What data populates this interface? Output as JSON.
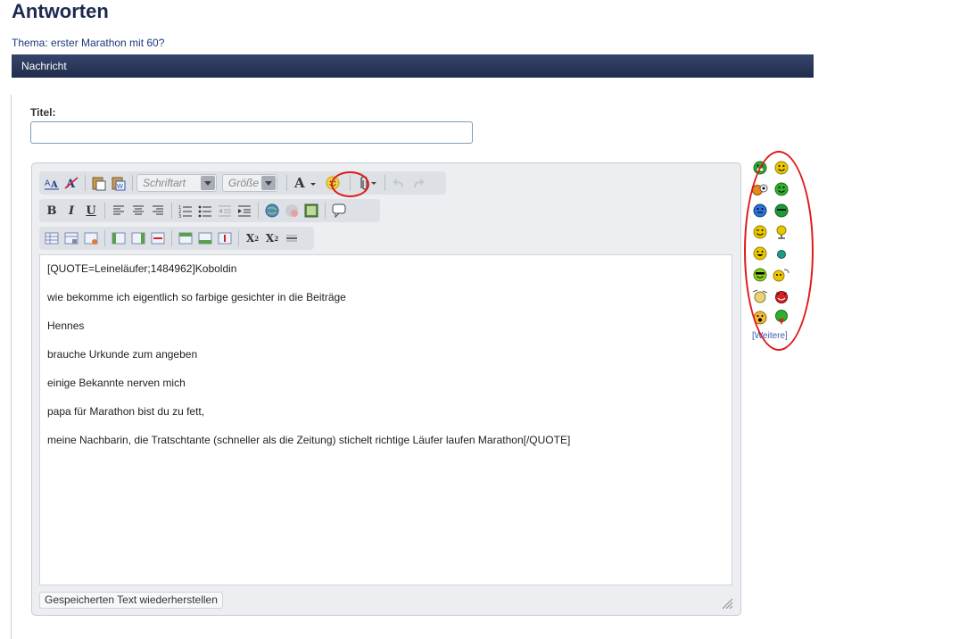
{
  "page": {
    "heading": "Antworten",
    "thread_title": "Thema: erster Marathon mit 60?",
    "section_bar": "Nachricht"
  },
  "form": {
    "title_label": "Titel:",
    "title_value": ""
  },
  "toolbar": {
    "font_placeholder": "Schriftart",
    "size_placeholder": "Größe",
    "icons_row1": [
      "remove-format-icon",
      "font-color-icon",
      "paste-icon",
      "paste-word-icon",
      "font-family-select",
      "font-size-select",
      "text-color-icon",
      "smilie-icon",
      "attachment-icon",
      "undo-icon",
      "redo-icon"
    ],
    "icons_row2": [
      "bold-icon",
      "italic-icon",
      "underline-icon",
      "align-left-icon",
      "align-center-icon",
      "align-right-icon",
      "ordered-list-icon",
      "unordered-list-icon",
      "outdent-icon",
      "indent-icon",
      "link-icon",
      "unlink-icon",
      "image-icon",
      "quote-icon"
    ],
    "icons_row3": [
      "table-icon",
      "table-props-icon",
      "table-delete-icon",
      "col-before-icon",
      "col-after-icon",
      "col-delete-icon",
      "row-before-icon",
      "row-after-icon",
      "row-delete-icon",
      "subscript-icon",
      "superscript-icon",
      "horizontal-rule-icon"
    ]
  },
  "editor": {
    "lines": [
      "[QUOTE=Leineläufer;1484962]Koboldin",
      "wie bekomme ich eigentlich so farbige gesichter in die Beiträge",
      "Hennes",
      "brauche Urkunde zum angeben",
      "einige Bekannte nerven mich",
      "papa für Marathon bist du zu fett,",
      "meine Nachbarin, die Tratschtante (schneller als die Zeitung) stichelt richtige Läufer laufen Marathon[/QUOTE]"
    ],
    "restore_label": "Gespeicherten Text wiederherstellen"
  },
  "smilies": {
    "more_label": "[Weitere]",
    "colors": {
      "yellow": "#e9c700",
      "green": "#2fae2f",
      "blue": "#2a72d6",
      "red": "#d62222",
      "orange": "#e58a1b",
      "annotation": "#e11919"
    }
  }
}
